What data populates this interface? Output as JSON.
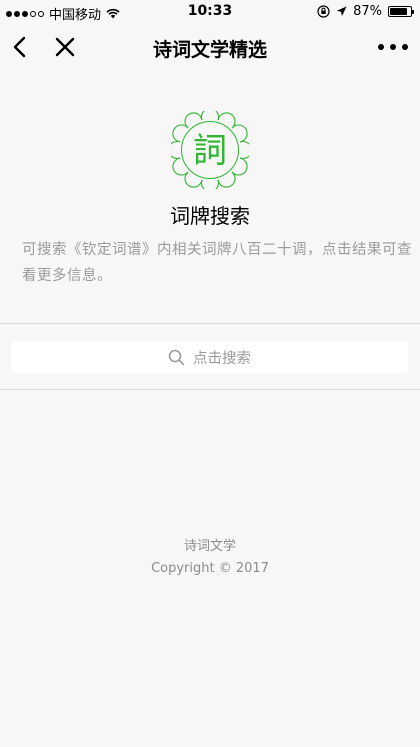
{
  "status_bar": {
    "carrier": "中国移动",
    "time": "10:33",
    "battery_text": "87%",
    "battery_level": 0.87
  },
  "nav": {
    "title": "诗词文学精选"
  },
  "logo": {
    "glyph": "詞",
    "color": "#2fb52f"
  },
  "page": {
    "title": "词牌搜索",
    "description": "可搜索《钦定词谱》内相关词牌八百二十调，点击结果可查看更多信息。"
  },
  "search": {
    "placeholder": "点击搜索"
  },
  "footer": {
    "line1": "诗词文学",
    "line2": "Copyright © 2017"
  },
  "icons": {
    "back": "chevron-left-icon",
    "close": "close-icon",
    "more": "more-dots-icon",
    "search": "search-icon",
    "wifi": "wifi-icon",
    "lock_rotation": "orientation-lock-icon",
    "location": "location-arrow-icon",
    "battery": "battery-icon"
  }
}
